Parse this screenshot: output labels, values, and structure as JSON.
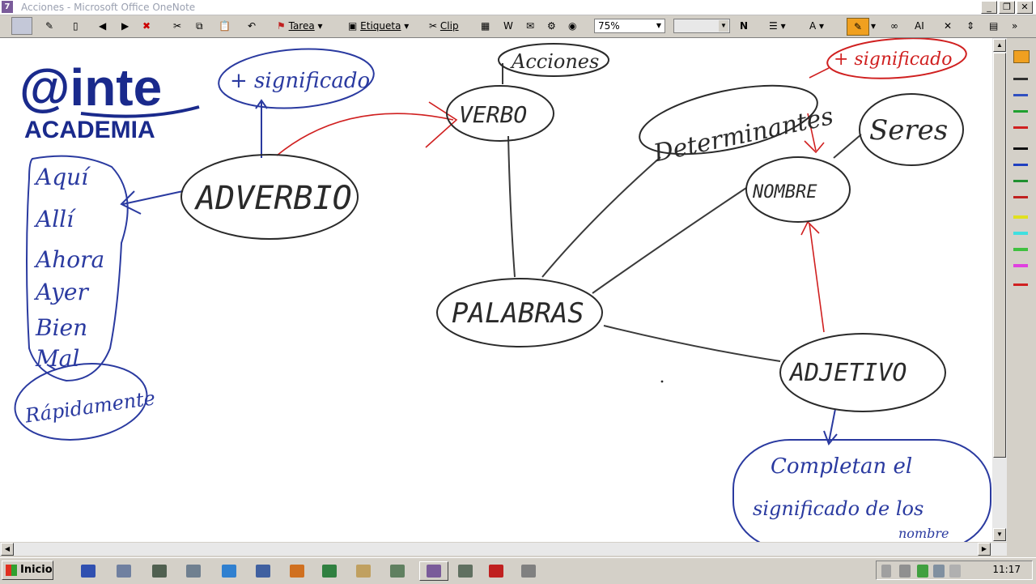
{
  "window": {
    "title": "Acciones - Microsoft Office OneNote",
    "app_icon": "onenote-icon"
  },
  "toolbar": {
    "tarea_label": "Tarea",
    "etiqueta_label": "Etiqueta",
    "clip_label": "Clip",
    "zoom_value": "75%",
    "font_value": ""
  },
  "logo": {
    "top": "@inte",
    "bottom": "ACADEMIA",
    "color": "#1a2a8c"
  },
  "diagram": {
    "adverbio": "ADVERBIO",
    "mas_significado_left": "+ significado",
    "adverb_list": [
      "Aquí",
      "Allí",
      "Ahora",
      "Ayer",
      "Bien",
      "Mal"
    ],
    "rapidamente": "Rápidamente",
    "verbo": "VERBO",
    "acciones": "Acciones",
    "determinantes": "Determinantes",
    "mas_significado_right": "+ significado",
    "seres": "Seres",
    "nombre": "NOMBRE",
    "palabras": "PALABRAS",
    "adjetivo": "ADJETIVO",
    "completan": [
      "Completan el",
      "significado de los",
      "nombre"
    ]
  },
  "colors": {
    "ink_black": "#2a2a2a",
    "ink_blue": "#2a3aa0",
    "ink_red": "#d02020"
  },
  "taskbar": {
    "start_label": "Inicio",
    "clock": "11:17"
  }
}
